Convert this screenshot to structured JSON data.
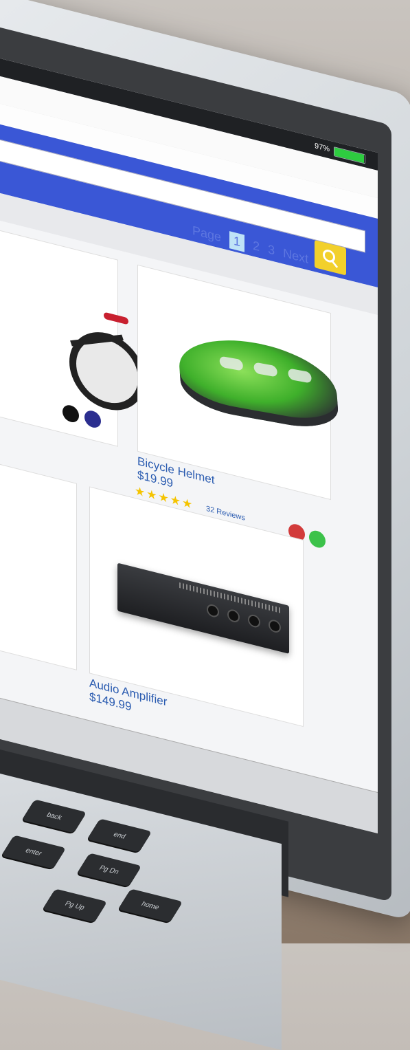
{
  "browser": {
    "battery_percent": "97%",
    "battery_level": 0.97
  },
  "search": {
    "placeholder": "",
    "button_icon": "search-icon"
  },
  "pagination": {
    "label": "Page",
    "pages": [
      "1",
      "2",
      "3"
    ],
    "current": "1",
    "next_label": "Next"
  },
  "products": [
    {
      "name": "Bicycle Helmet",
      "price": "$19.99",
      "rating_stars": "★★★★★",
      "rating_value": 5,
      "reviews": "32 Reviews",
      "swatch_colors": [
        "#d23b3b",
        "#3cc24a"
      ]
    },
    {
      "name": "Audio Amplifier",
      "price": "$149.99"
    }
  ],
  "bike_card": {
    "swatch_colors": [
      "#111111",
      "#2b2e8f"
    ]
  },
  "colors": {
    "nav_blue": "#3a57d6",
    "search_yellow": "#f2d02b",
    "link_blue": "#2a5bb0",
    "star_yellow": "#f5c400",
    "battery_green": "#2ecc40"
  },
  "keyboard": {
    "keys": [
      "back",
      "enter",
      "end",
      "Pg Dn",
      "Pg Up",
      "home"
    ]
  }
}
